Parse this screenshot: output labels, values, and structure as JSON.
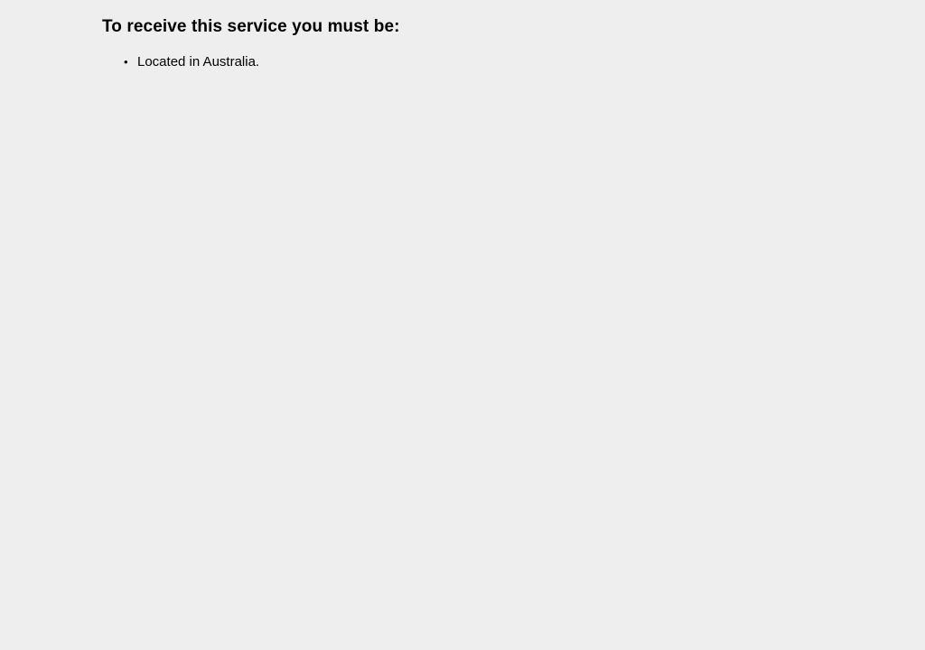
{
  "requirements": {
    "heading": "To receive this service you must be:",
    "items": [
      {
        "bullet": "•",
        "text": "Located in Australia."
      }
    ]
  }
}
